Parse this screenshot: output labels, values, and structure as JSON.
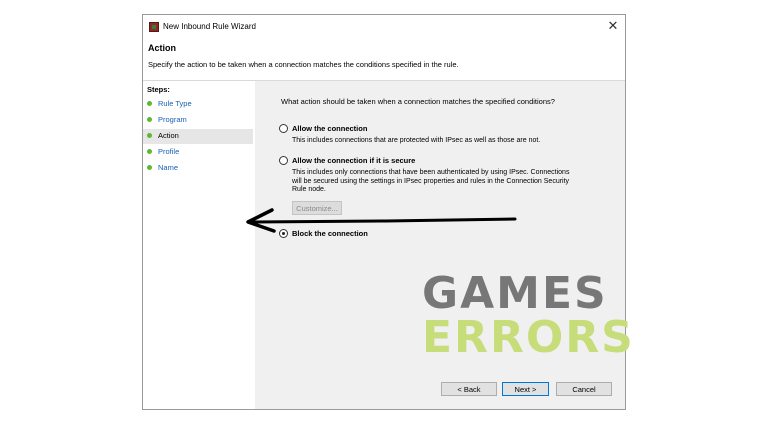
{
  "window": {
    "title": "New Inbound Rule Wizard",
    "page_title": "Action",
    "page_description": "Specify the action to be taken when a connection matches the conditions specified in the rule."
  },
  "steps": {
    "title": "Steps:",
    "items": [
      {
        "label": "Rule Type"
      },
      {
        "label": "Program"
      },
      {
        "label": "Action"
      },
      {
        "label": "Profile"
      },
      {
        "label": "Name"
      }
    ]
  },
  "content": {
    "question": "What action should be taken when a connection matches the specified conditions?",
    "options": [
      {
        "label": "Allow the connection",
        "description": "This includes connections that are protected with IPsec as well as those are not.",
        "selected": false
      },
      {
        "label": "Allow the connection if it is secure",
        "description_lines": [
          "This includes only connections that have been authenticated by using IPsec. Connections",
          "will be secured using the settings in IPsec properties and rules in the Connection Security",
          "Rule node."
        ],
        "selected": false
      },
      {
        "label": "Block the connection",
        "selected": true
      }
    ],
    "customize_label": "Customize..."
  },
  "buttons": {
    "back": "< Back",
    "next": "Next >",
    "cancel": "Cancel"
  },
  "watermark": {
    "line1": "GAMES",
    "line2": "ERRORS"
  },
  "colors": {
    "step_dot": "#5fb834",
    "link": "#1a5fb4",
    "panel_bg": "#f0f0f0",
    "watermark_gray": "#777777",
    "watermark_green": "#c6dd79"
  }
}
